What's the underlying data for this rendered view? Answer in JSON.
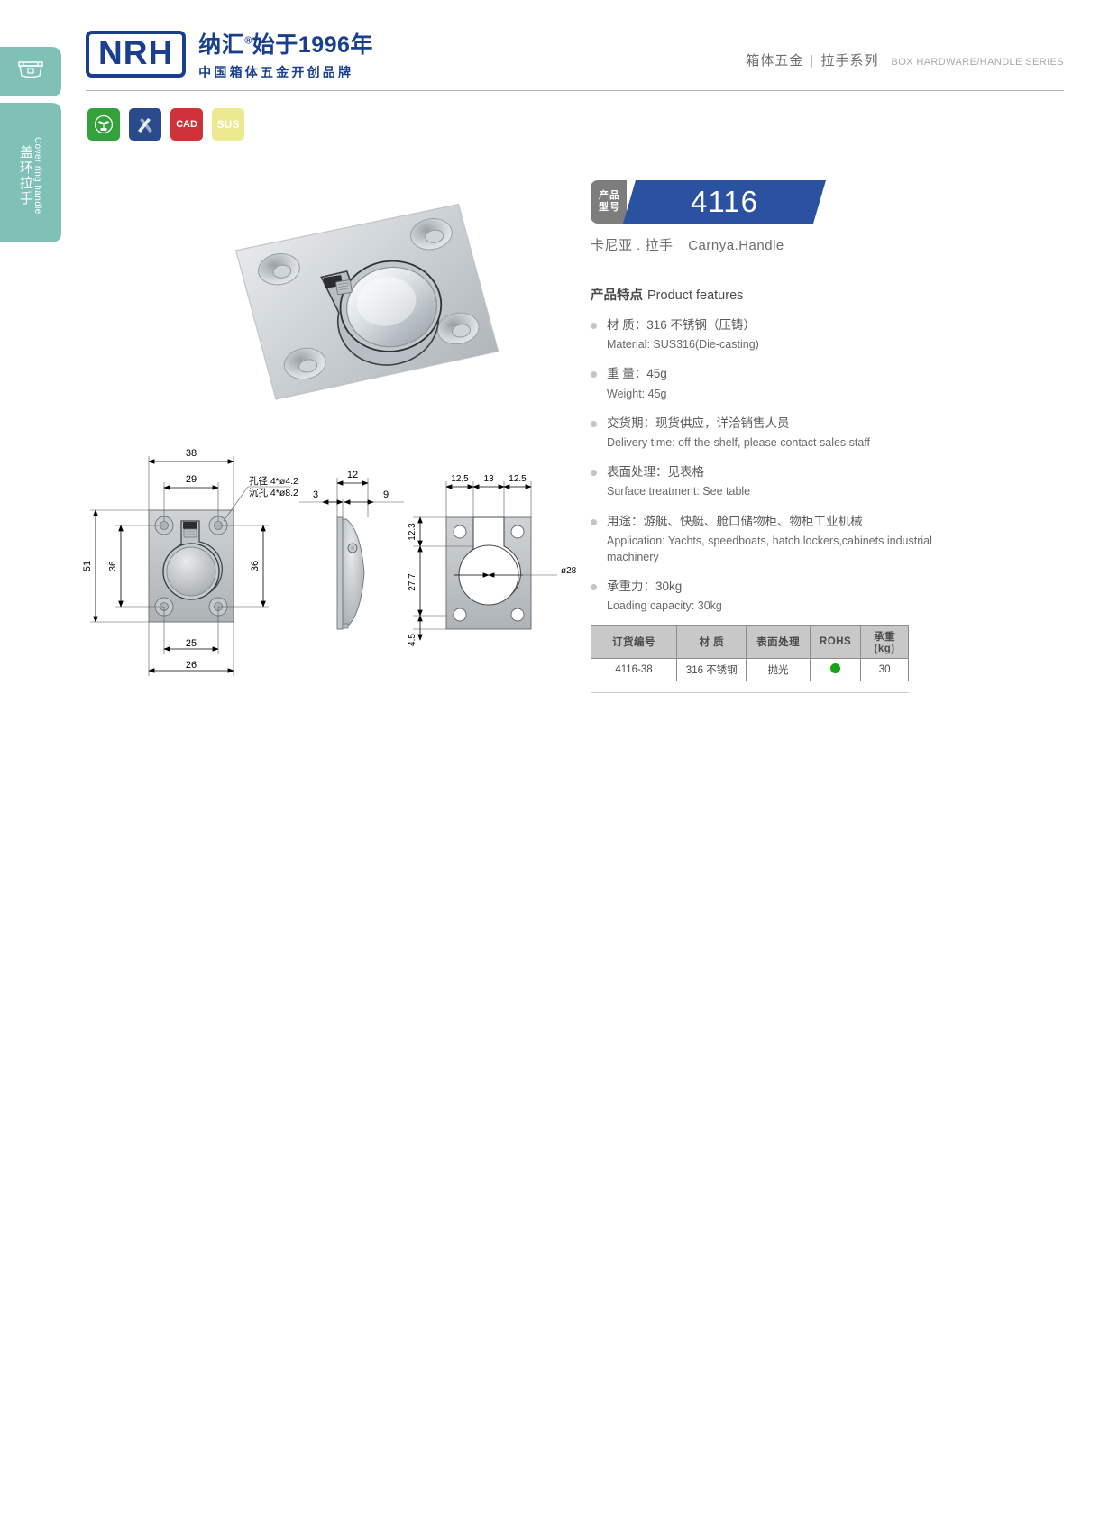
{
  "sidebar": {
    "icon": "cover-ring-handle-icon",
    "label_cn": "盖环拉手",
    "label_en": "Cover ring handle"
  },
  "header": {
    "logo_mark": "NRH",
    "logo_cn": "纳汇",
    "logo_reg": "®",
    "logo_slogan": "始于1996年",
    "logo_sub": "中国箱体五金开创品牌",
    "category_cn": "箱体五金",
    "category_sep": "|",
    "series_cn": "拉手系列",
    "category_en": "BOX HARDWARE/HANDLE SERIES"
  },
  "badges": [
    {
      "name": "rohs-eco-badge",
      "label": "",
      "color": "#34a13c"
    },
    {
      "name": "drawing-tools-badge",
      "label": "",
      "color": "#2a4a8b"
    },
    {
      "name": "cad-badge",
      "label": "CAD",
      "color": "#cf3239"
    },
    {
      "name": "sus-badge",
      "label": "SUS",
      "color": "#ecea90"
    }
  ],
  "product": {
    "tag_line1": "产品",
    "tag_line2": "型号",
    "model": "4116",
    "name_cn": "卡尼亚 . 拉手",
    "name_en": "Carnya.Handle",
    "photo_alt": "stainless-steel-flush-ring-pull-handle"
  },
  "features": {
    "title_cn": "产品特点",
    "title_en": "Product features",
    "items": [
      {
        "cn": "材  质：316 不锈钢（压铸）",
        "en": "Material: SUS316(Die-casting)"
      },
      {
        "cn": "重  量：45g",
        "en": "Weight: 45g"
      },
      {
        "cn": "交货期：现货供应，详洽销售人员",
        "en": "Delivery time: off-the-shelf, please contact sales staff"
      },
      {
        "cn": "表面处理：见表格",
        "en": "Surface treatment: See table"
      },
      {
        "cn": "用途：游艇、快艇、舱口储物柜、物柜工业机械",
        "en": "Application: Yachts, speedboats, hatch lockers,cabinets industrial machinery"
      },
      {
        "cn": "承重力：30kg",
        "en": "Loading capacity: 30kg"
      }
    ]
  },
  "spec_table": {
    "headers": [
      "订货编号",
      "材    质",
      "表面处理",
      "ROHS",
      "承重 (kg)"
    ],
    "rows": [
      {
        "order_no": "4116-38",
        "material": "316 不锈钢",
        "surface": "抛光",
        "rohs": "green-dot",
        "load": "30"
      }
    ]
  },
  "drawings": {
    "front_view": {
      "name": "front-view",
      "dims": {
        "width_outer": "38",
        "hole_span_h": "29",
        "height_outer": "51",
        "hole_span_v": "36",
        "inner_w": "25",
        "inner_w2": "26",
        "hole_note_1": "孔径 4*ø4.2",
        "hole_note_2": "沉孔 4*ø8.2"
      }
    },
    "side_view": {
      "name": "side-view",
      "dims": {
        "depth": "12",
        "lip": "3",
        "body": "9"
      }
    },
    "section_view": {
      "name": "section-view",
      "dims": {
        "left": "12.5",
        "center": "13",
        "right": "12.5",
        "top_gap": "12.3",
        "bore_height": "27.7",
        "bottom": "4.5",
        "bore_dia": "ø28"
      }
    }
  },
  "colors": {
    "brand_blue": "#1b3f8f",
    "banner_blue": "#2a52a0",
    "sidebar_teal": "#7fc0b7",
    "tag_grey": "#7d7d7d",
    "rohs_green": "#17a317"
  }
}
